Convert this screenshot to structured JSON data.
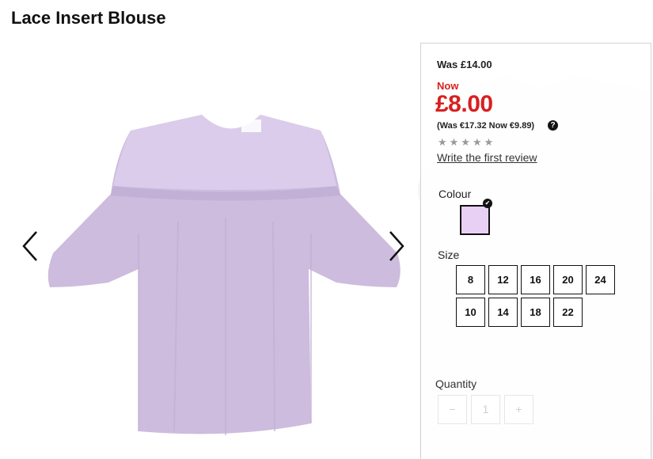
{
  "product": {
    "title": "Lace Insert Blouse"
  },
  "price": {
    "was": "Was £14.00",
    "now_label": "Now",
    "now": "£8.00",
    "alt_currency": "(Was €17.32 Now €9.89)"
  },
  "rating": {
    "stars": "★★★★★",
    "review_link": "Write the first review"
  },
  "colour": {
    "label": "Colour",
    "selected_swatch": "#e8d0f4"
  },
  "size": {
    "label": "Size",
    "options": [
      "8",
      "12",
      "16",
      "20",
      "24",
      "10",
      "14",
      "18",
      "22"
    ]
  },
  "quantity": {
    "label": "Quantity",
    "minus": "−",
    "value": "1",
    "plus": "+"
  },
  "colors": {
    "price_red": "#d81f1f",
    "blouse": "#cdbcde"
  },
  "icons": {
    "prev": "chevron-left-icon",
    "next": "chevron-right-icon",
    "help": "question-circle-icon",
    "check": "check-icon"
  }
}
